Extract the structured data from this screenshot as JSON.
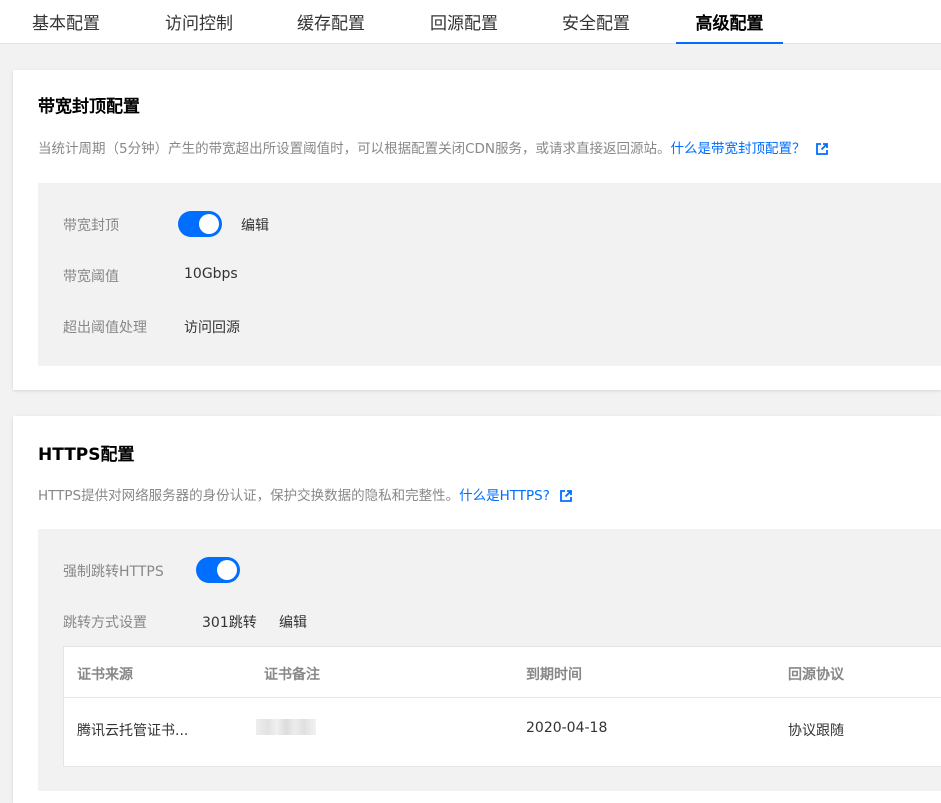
{
  "tabs": [
    {
      "label": "基本配置",
      "active": false
    },
    {
      "label": "访问控制",
      "active": false
    },
    {
      "label": "缓存配置",
      "active": false
    },
    {
      "label": "回源配置",
      "active": false
    },
    {
      "label": "安全配置",
      "active": false
    },
    {
      "label": "高级配置",
      "active": true
    }
  ],
  "bandwidth_cap": {
    "title": "带宽封顶配置",
    "description": "当统计周期（5分钟）产生的带宽超出所设置阈值时，可以根据配置关闭CDN服务，或请求直接返回源站。",
    "help_link": "什么是带宽封顶配置？",
    "rows": {
      "cap_label": "带宽封顶",
      "cap_enabled": true,
      "edit_label": "编辑",
      "threshold_label": "带宽阈值",
      "threshold_value": "10Gbps",
      "exceed_label": "超出阈值处理",
      "exceed_value": "访问回源"
    }
  },
  "https": {
    "title": "HTTPS配置",
    "description": "HTTPS提供对网络服务器的身份认证，保护交换数据的隐私和完整性。",
    "help_link": "什么是HTTPS?",
    "force_label": "强制跳转HTTPS",
    "force_enabled": true,
    "redirect_label": "跳转方式设置",
    "redirect_value": "301跳转",
    "edit_label": "编辑",
    "table": {
      "headers": [
        "证书来源",
        "证书备注",
        "到期时间",
        "回源协议"
      ],
      "rows": [
        {
          "source": "腾讯云托管证书...",
          "note": "",
          "expiry": "2020-04-18",
          "protocol": "协议跟随"
        }
      ]
    }
  },
  "colors": {
    "accent": "#006eff",
    "muted_text": "#888888",
    "panel_bg": "#f2f2f2"
  }
}
